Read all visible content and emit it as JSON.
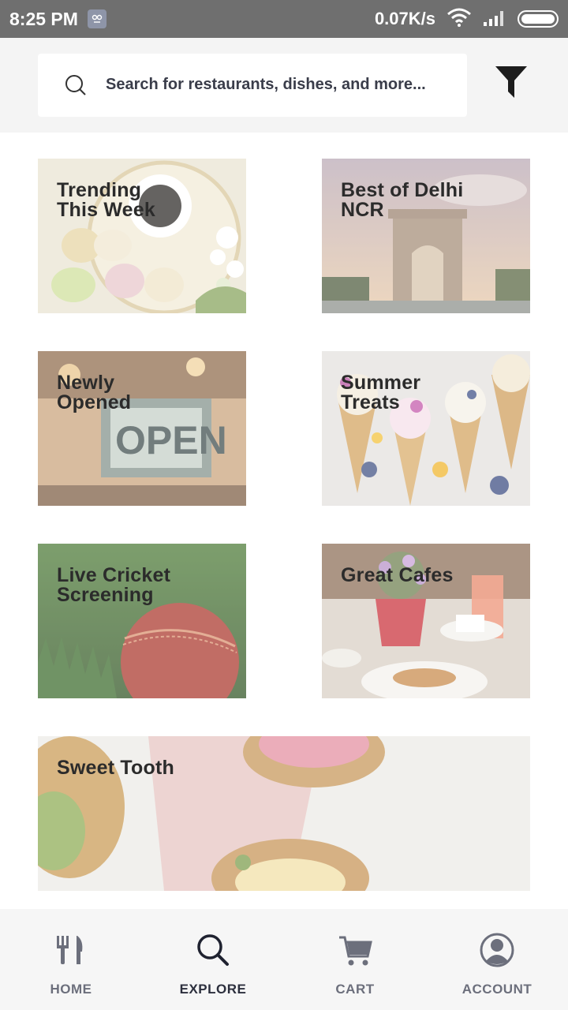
{
  "status_bar": {
    "time": "8:25 PM",
    "speed": "0.07K/s",
    "icons": [
      "notification-app-icon",
      "wifi-icon",
      "signal-icon",
      "battery-icon"
    ]
  },
  "search": {
    "placeholder": "Search for restaurants, dishes, and more...",
    "icon": "search-icon",
    "filter_icon": "filter-icon"
  },
  "collections": [
    {
      "title": "Trending\nThis Week",
      "image": "macarons-and-coffee"
    },
    {
      "title": "Best of Delhi\nNCR",
      "image": "india-gate"
    },
    {
      "title": "Newly\nOpened",
      "image": "open-sign"
    },
    {
      "title": "Summer\nTreats",
      "image": "ice-cream-cones"
    },
    {
      "title": "Live Cricket\nScreening",
      "image": "cricket-ball-on-grass"
    },
    {
      "title": "Great Cafes",
      "image": "cafe-table"
    },
    {
      "title": "Sweet Tooth",
      "image": "cupcakes"
    }
  ],
  "bottom_nav": [
    {
      "label": "HOME",
      "icon": "fork-knife-icon",
      "active": false
    },
    {
      "label": "EXPLORE",
      "icon": "search-icon",
      "active": true
    },
    {
      "label": "CART",
      "icon": "cart-icon",
      "active": false
    },
    {
      "label": "ACCOUNT",
      "icon": "account-icon",
      "active": false
    }
  ],
  "colors": {
    "status_bar": "#6f6f6f",
    "nav_active": "#2c2f3d",
    "nav_inactive": "#6c6f7c"
  }
}
